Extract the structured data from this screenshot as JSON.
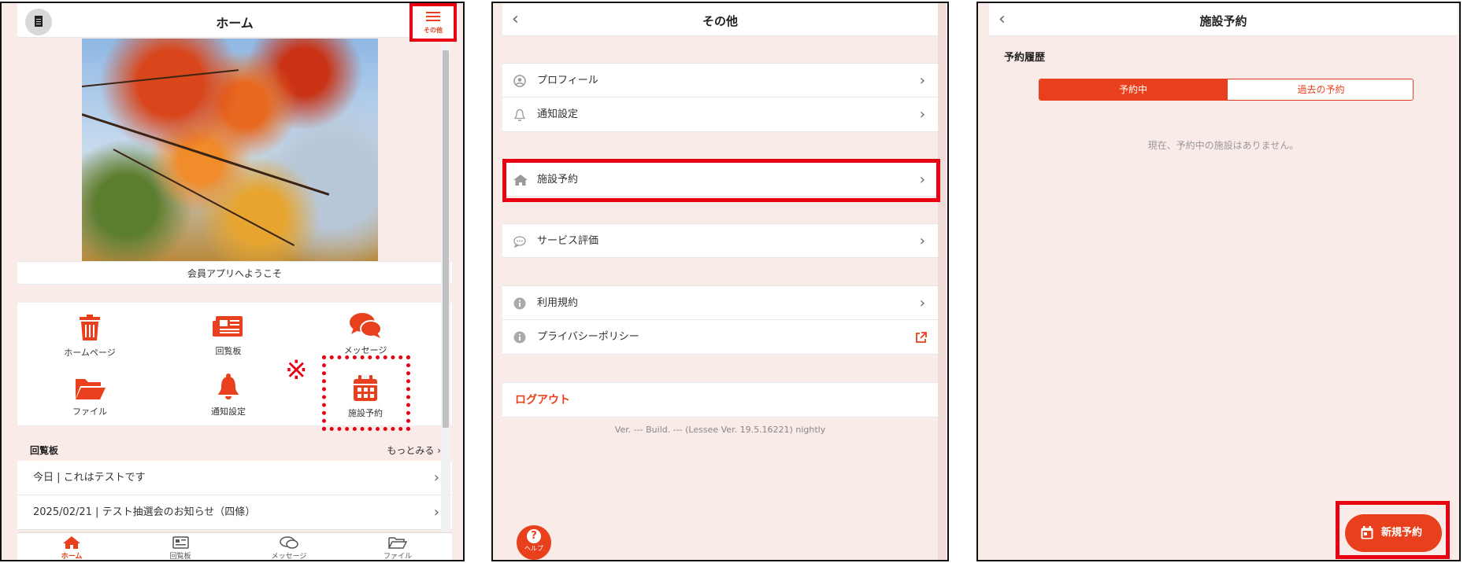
{
  "colors": {
    "accent": "#e8401c",
    "highlight": "#e60012",
    "background": "#f9ebe8"
  },
  "home": {
    "title": "ホーム",
    "menu_label": "その他",
    "welcome": "会員アプリへようこそ",
    "grid": [
      {
        "label": "ホームページ",
        "icon": "trash-icon"
      },
      {
        "label": "回覧板",
        "icon": "newspaper-icon"
      },
      {
        "label": "メッセージ",
        "icon": "chat-icon"
      },
      {
        "label": "ファイル",
        "icon": "folder-icon"
      },
      {
        "label": "通知設定",
        "icon": "bell-icon"
      },
      {
        "label": "施設予約",
        "icon": "calendar-icon"
      }
    ],
    "note_mark": "※",
    "circular_title": "回覧板",
    "more": "もっとみる",
    "circulars": [
      "今日 | これはテストです",
      "2025/02/21 | テスト抽選会のお知らせ（四條）"
    ],
    "tabs": [
      {
        "label": "ホーム",
        "icon": "home-icon"
      },
      {
        "label": "回覧板",
        "icon": "newspaper-icon"
      },
      {
        "label": "メッセージ",
        "icon": "chat-icon"
      },
      {
        "label": "ファイル",
        "icon": "folder-icon"
      }
    ]
  },
  "other": {
    "title": "その他",
    "items": [
      {
        "label": "プロフィール",
        "icon": "user-icon"
      },
      {
        "label": "通知設定",
        "icon": "bell-icon"
      },
      {
        "label": "施設予約",
        "icon": "home-icon"
      },
      {
        "label": "サービス評価",
        "icon": "chat-icon"
      },
      {
        "label": "利用規約",
        "icon": "info-icon"
      },
      {
        "label": "プライバシーポリシー",
        "icon": "info-icon"
      }
    ],
    "logout": "ログアウト",
    "version": "Ver. --- Build. --- (Lessee Ver. 19.5.16221) nightly",
    "help": "ヘルプ"
  },
  "reservation": {
    "title": "施設予約",
    "history": "予約履歴",
    "tab_active": "予約中",
    "tab_past": "過去の予約",
    "empty": "現在、予約中の施設はありません。",
    "new_button": "新規予約"
  }
}
